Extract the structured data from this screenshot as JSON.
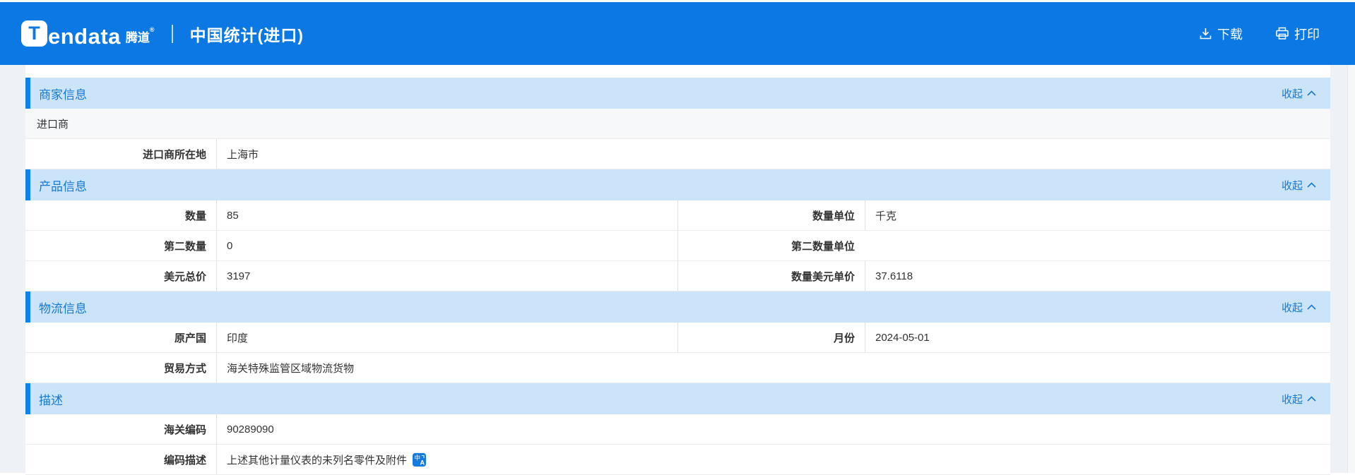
{
  "colors": {
    "topbar": "#0b78e3",
    "section_bg": "#cbe4f9",
    "section_accent": "#0f82ea",
    "section_text": "#1779d6",
    "link": "#1779d6",
    "translate_icon": "#1679df"
  },
  "header": {
    "logo": {
      "brand_t": "T",
      "brand_rest": "endata",
      "brand_cn": "腾道",
      "reg_mark": "®"
    },
    "title": "中国统计(进口)",
    "actions": {
      "download": "下载",
      "print": "打印"
    },
    "icons": {
      "download": "download-icon",
      "print": "print-icon"
    }
  },
  "collapse_label": "收起",
  "collapse_icon": "chevron-up-icon",
  "sections": [
    {
      "title": "商家信息",
      "rows": [
        {
          "type": "text",
          "text": "进口商"
        },
        {
          "type": "pairs",
          "full": true,
          "pairs": [
            {
              "label": "进口商所在地",
              "value": "上海市"
            }
          ]
        }
      ]
    },
    {
      "title": "产品信息",
      "rows": [
        {
          "type": "pairs",
          "pairs": [
            {
              "label": "数量",
              "value": "85"
            },
            {
              "label": "数量单位",
              "value": "千克"
            }
          ]
        },
        {
          "type": "pairs",
          "pairs": [
            {
              "label": "第二数量",
              "value": "0"
            },
            {
              "label": "第二数量单位",
              "value": ""
            }
          ]
        },
        {
          "type": "pairs",
          "pairs": [
            {
              "label": "美元总价",
              "value": "3197"
            },
            {
              "label": "数量美元单价",
              "value": "37.6118"
            }
          ]
        }
      ]
    },
    {
      "title": "物流信息",
      "rows": [
        {
          "type": "pairs",
          "pairs": [
            {
              "label": "原产国",
              "value": "印度"
            },
            {
              "label": "月份",
              "value": "2024-05-01"
            }
          ]
        },
        {
          "type": "pairs",
          "full": true,
          "pairs": [
            {
              "label": "贸易方式",
              "value": "海关特殊监管区域物流货物"
            }
          ]
        }
      ]
    },
    {
      "title": "描述",
      "rows": [
        {
          "type": "pairs",
          "full": true,
          "pairs": [
            {
              "label": "海关编码",
              "value": "90289090"
            }
          ]
        },
        {
          "type": "pairs",
          "full": true,
          "pairs": [
            {
              "label": "编码描述",
              "value": "上述其他计量仪表的未列名零件及附件",
              "icon": "translate-icon"
            }
          ]
        }
      ]
    }
  ]
}
